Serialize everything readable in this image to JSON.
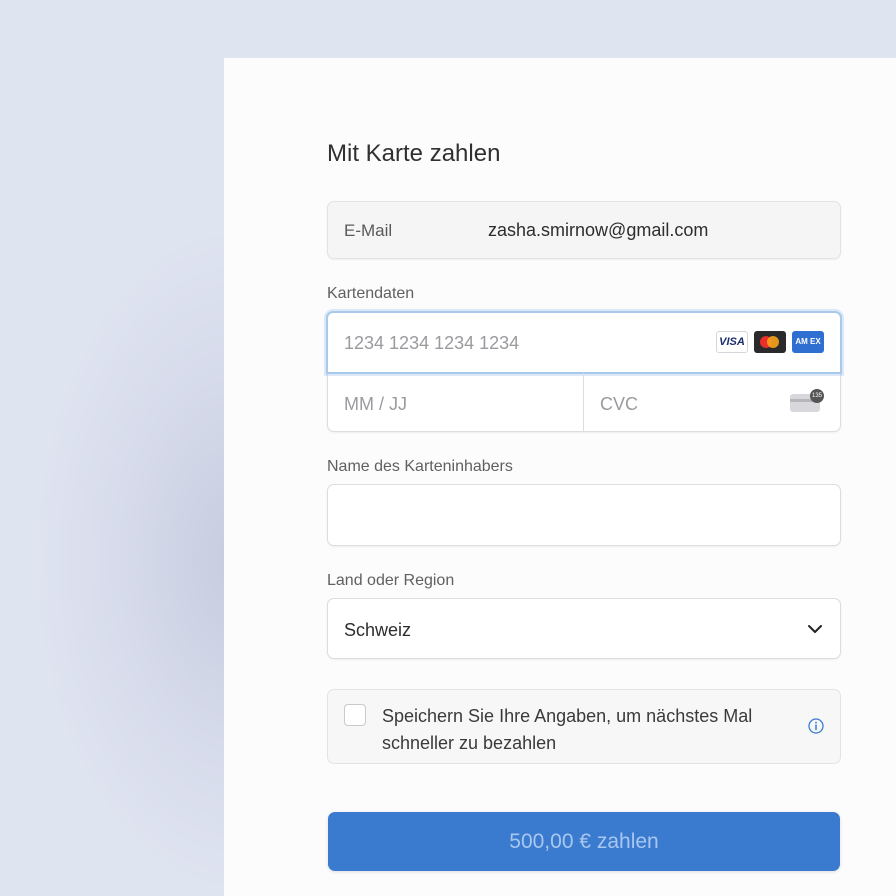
{
  "form": {
    "title": "Mit Karte zahlen",
    "email": {
      "label": "E-Mail",
      "value": "zasha.smirnow@gmail.com"
    },
    "card": {
      "section_label": "Kartendaten",
      "number_placeholder": "1234 1234 1234 1234",
      "expiry_placeholder": "MM / JJ",
      "cvc_placeholder": "CVC",
      "brands": {
        "visa": "VISA",
        "amex": "AM EX"
      },
      "cvc_badge": "135"
    },
    "cardholder": {
      "label": "Name des Karteninhabers",
      "value": ""
    },
    "country": {
      "label": "Land oder Region",
      "selected": "Schweiz"
    },
    "save": {
      "text": "Speichern Sie Ihre Angaben, um nächstes Mal schneller zu bezahlen"
    },
    "pay_button": "500,00 € zahlen"
  },
  "colors": {
    "accent": "#3a7bd0",
    "focus_ring": "#a9c9ea",
    "background": "#dfe4f1"
  },
  "icons": {
    "visa": "visa-logo-icon",
    "mastercard": "mastercard-logo-icon",
    "amex": "amex-logo-icon",
    "cvc": "cvc-card-icon",
    "chevron": "chevron-down-icon",
    "info": "info-icon"
  }
}
